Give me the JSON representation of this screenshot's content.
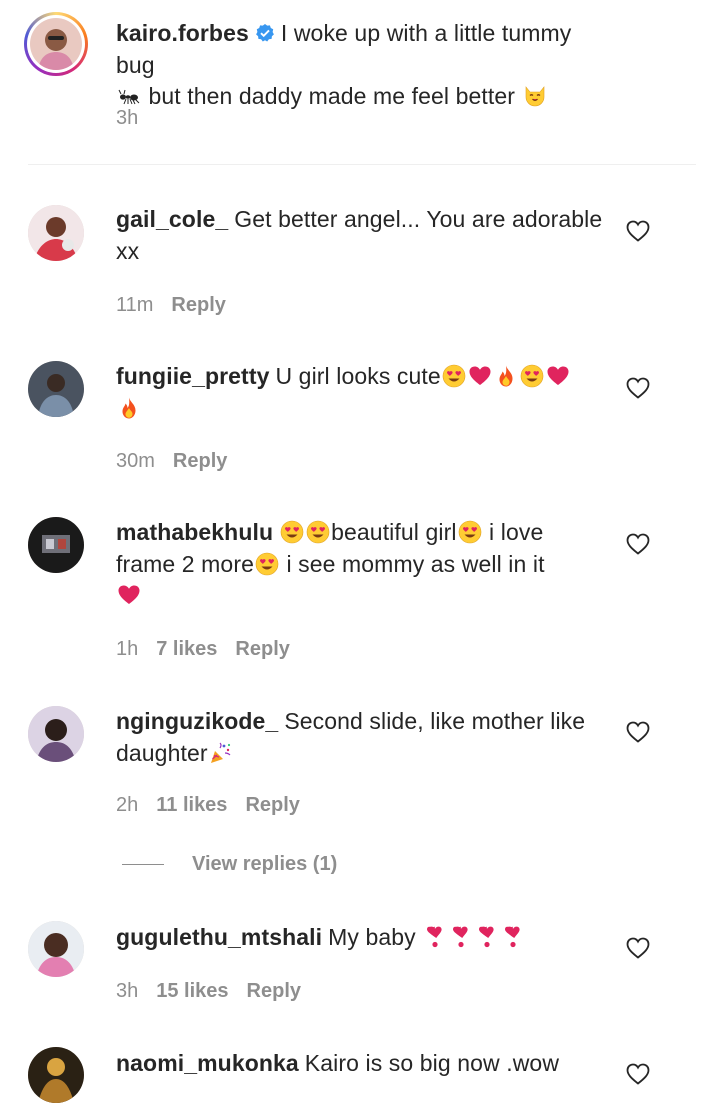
{
  "caption": {
    "username": "kairo.forbes",
    "verified": true,
    "text_before": "I woke up with a little tummy bug",
    "text_after": " but then daddy made me feel better",
    "time": "3h"
  },
  "comments": [
    {
      "username": "gail_cole_",
      "text": "Get better angel... You are adorable xx",
      "time": "11m",
      "likes": "",
      "reply": "Reply"
    },
    {
      "username": "fungiie_pretty",
      "text": "U girl looks cute",
      "emoji": [
        "heart-eyes",
        "red-heart",
        "fire",
        "heart-eyes",
        "red-heart",
        "fire"
      ],
      "time": "30m",
      "likes": "",
      "reply": "Reply"
    },
    {
      "username": "mathabekhulu",
      "text_parts": [
        "beautiful girl",
        " i love frame 2 more",
        " i see mommy as well in it"
      ],
      "time": "1h",
      "likes": "7 likes",
      "reply": "Reply"
    },
    {
      "username": "nginguzikode_",
      "text": "Second slide, like mother like daughter",
      "time": "2h",
      "likes": "11 likes",
      "reply": "Reply",
      "view_replies": "View replies (1)"
    },
    {
      "username": "gugulethu_mtshali",
      "text": "My baby",
      "time": "3h",
      "likes": "15 likes",
      "reply": "Reply"
    },
    {
      "username": "naomi_mukonka",
      "text": "Kairo is so big now .wow",
      "time": "",
      "likes": "",
      "reply": ""
    }
  ],
  "icons": {
    "verified": "verified-badge-icon",
    "like": "heart-outline-icon"
  },
  "colors": {
    "text": "#262626",
    "meta": "#8e8e8e",
    "verified_blue": "#3897f0",
    "emoji_red": "#e0245e"
  }
}
